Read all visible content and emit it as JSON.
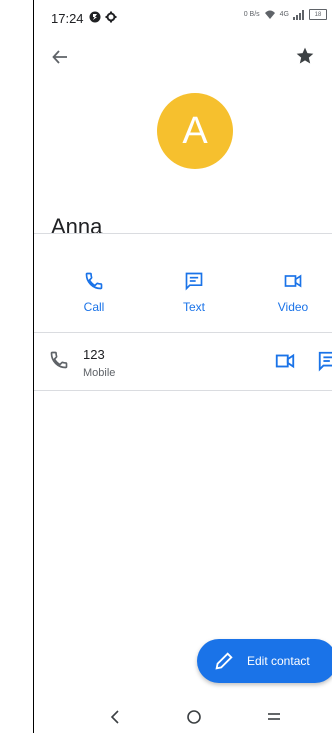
{
  "status_bar": {
    "time": "17:24",
    "net_speed": "0 B/s",
    "signal_label": "4G",
    "battery": "18"
  },
  "contact": {
    "initial": "A",
    "name": "Anna",
    "avatar_color": "#f6c02e"
  },
  "actions": [
    {
      "label": "Call",
      "icon": "phone-icon"
    },
    {
      "label": "Text",
      "icon": "message-icon"
    },
    {
      "label": "Video",
      "icon": "video-icon"
    }
  ],
  "phone_entry": {
    "number": "123",
    "type": "Mobile"
  },
  "fab": {
    "label": "Edit contact",
    "icon": "pencil-icon"
  },
  "colors": {
    "accent": "#1a73e8",
    "divider": "#dadce0"
  }
}
